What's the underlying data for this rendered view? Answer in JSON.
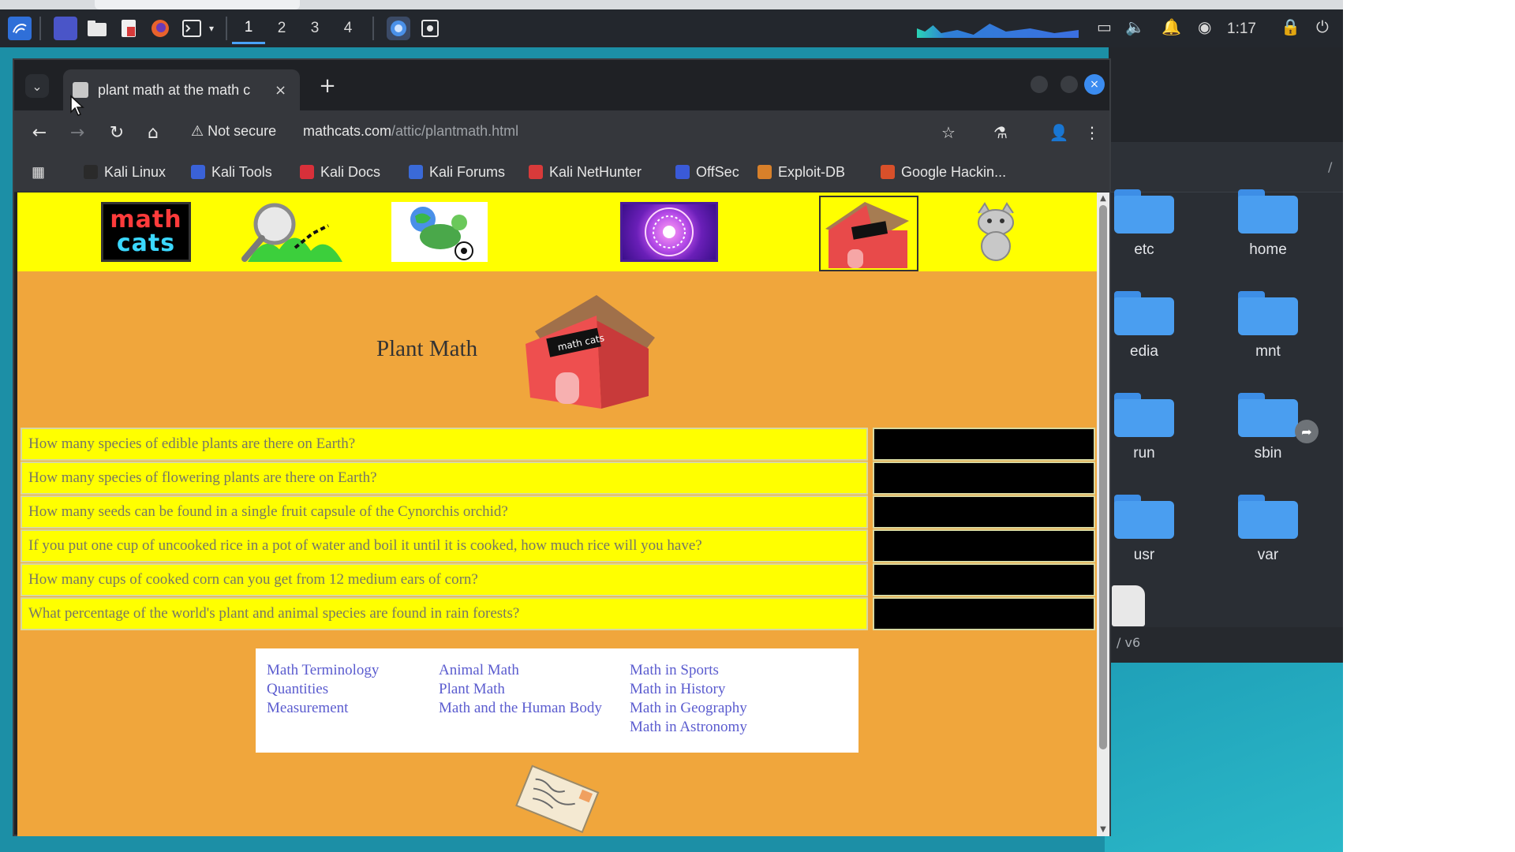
{
  "taskbar": {
    "workspaces": [
      "1",
      "2",
      "3",
      "4"
    ],
    "active_workspace": "1",
    "clock": "1:17"
  },
  "browser": {
    "tab": {
      "title": "plant math at the math c",
      "close": "×"
    },
    "new_tab": "+",
    "window_close": "×",
    "toolbar": {
      "security_label": "Not secure",
      "url_host": "mathcats.com",
      "url_path": "/attic/plantmath.html"
    },
    "bookmarks": [
      {
        "label": "Kali Linux",
        "color": "#2a2a2a"
      },
      {
        "label": "Kali Tools",
        "color": "#3a62d8"
      },
      {
        "label": "Kali Docs",
        "color": "#d8303a"
      },
      {
        "label": "Kali Forums",
        "color": "#3a6ad8"
      },
      {
        "label": "Kali NetHunter",
        "color": "#d83a3a"
      },
      {
        "label": "OffSec",
        "color": "#3a5ad8"
      },
      {
        "label": "Exploit-DB",
        "color": "#d8802a"
      },
      {
        "label": "Google Hackin...",
        "color": "#d8502a"
      }
    ]
  },
  "page": {
    "logo": {
      "line1": "math",
      "line2": "cats"
    },
    "title": "Plant Math",
    "questions": [
      "How many species of edible plants are there on Earth?",
      "How many species of flowering plants are there on Earth?",
      "How many seeds can be found in a single fruit capsule of the Cynorchis orchid?",
      "If you put one cup of uncooked rice in a pot of water and boil it until it is cooked, how much rice will you have?",
      "How many cups of cooked corn can you get from 12 medium ears of corn?",
      "What percentage of the world's plant and animal species are found in rain forests?"
    ],
    "links": {
      "col1": [
        "Math Terminology",
        "Quantities",
        "Measurement"
      ],
      "col2": [
        "Animal Math",
        "Plant Math",
        "Math and the Human Body"
      ],
      "col3": [
        "Math in Sports",
        "Math in History",
        "Math in Geography",
        "Math in Astronomy"
      ]
    }
  },
  "file_manager": {
    "folders": [
      {
        "label": "etc"
      },
      {
        "label": "home"
      },
      {
        "label": "edia"
      },
      {
        "label": "mnt"
      },
      {
        "label": "run"
      },
      {
        "label": "sbin"
      },
      {
        "label": "usr"
      },
      {
        "label": "var"
      }
    ],
    "status": "/ v6"
  },
  "colors": {
    "page_bg": "#f0a63c",
    "nav_strip": "#ffff00",
    "question_bg": "#ffff00",
    "answer_bg": "#000000",
    "link": "#5b5ccf",
    "folder": "#4a9ef0"
  }
}
